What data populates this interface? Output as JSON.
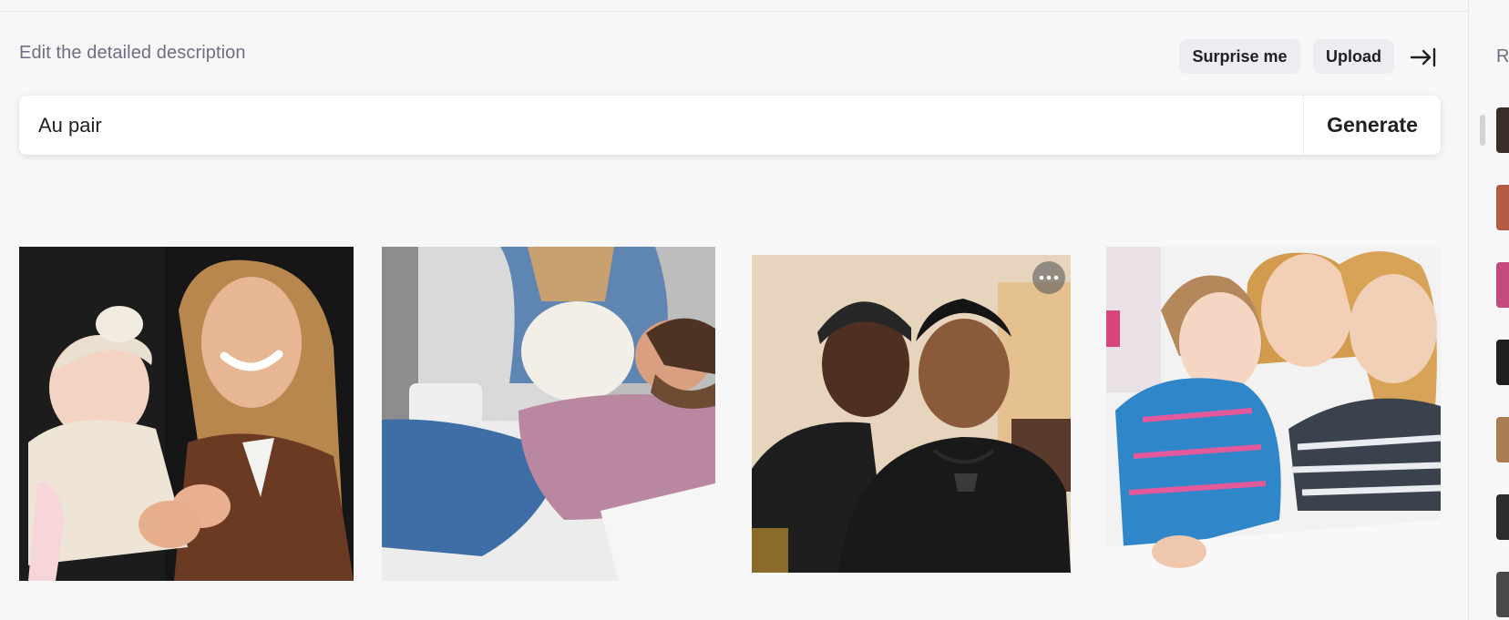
{
  "prompt": {
    "label": "Edit the detailed description",
    "value": "Au pair"
  },
  "actions": {
    "surprise_label": "Surprise me",
    "upload_label": "Upload",
    "generate_label": "Generate"
  },
  "sidebar": {
    "title_partial": "R"
  }
}
